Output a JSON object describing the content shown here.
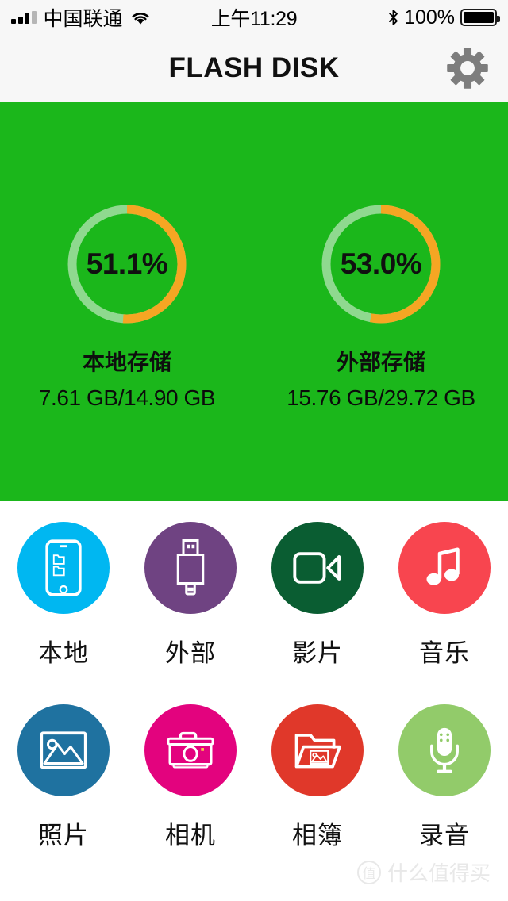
{
  "statusbar": {
    "carrier": "中国联通",
    "signal_icon": "signal-bars-icon",
    "wifi_icon": "wifi-icon",
    "time": "上午11:29",
    "bluetooth_icon": "bluetooth-icon",
    "battery_percent": "100%",
    "battery_icon": "battery-full-icon"
  },
  "navbar": {
    "title": "FLASH DISK",
    "settings_icon": "gear-icon"
  },
  "storage": {
    "panel_color": "#1bb71b",
    "track_color": "#8fd98f",
    "arc_color": "#f5a623",
    "gauges": [
      {
        "percent_label": "51.1%",
        "percent_value": 51.1,
        "name": "本地存储",
        "size": "7.61 GB/14.90 GB",
        "used_gb": 7.61,
        "total_gb": 14.9
      },
      {
        "percent_label": "53.0%",
        "percent_value": 53.0,
        "name": "外部存储",
        "size": "15.76 GB/29.72 GB",
        "used_gb": 15.76,
        "total_gb": 29.72
      }
    ]
  },
  "grid": {
    "rows": [
      [
        {
          "label": "本地",
          "icon": "phone-icon",
          "color": "#00b7f1"
        },
        {
          "label": "外部",
          "icon": "usb-drive-icon",
          "color": "#6f4382"
        },
        {
          "label": "影片",
          "icon": "video-camera-icon",
          "color": "#0a5d32"
        },
        {
          "label": "音乐",
          "icon": "music-note-icon",
          "color": "#f8454f"
        }
      ],
      [
        {
          "label": "照片",
          "icon": "picture-icon",
          "color": "#1f72a0"
        },
        {
          "label": "相机",
          "icon": "camera-icon",
          "color": "#e3037e"
        },
        {
          "label": "相簿",
          "icon": "photo-album-icon",
          "color": "#e0382a"
        },
        {
          "label": "录音",
          "icon": "microphone-icon",
          "color": "#92cb6a"
        }
      ]
    ]
  },
  "watermark": {
    "badge": "值",
    "text": "什么值得买"
  }
}
